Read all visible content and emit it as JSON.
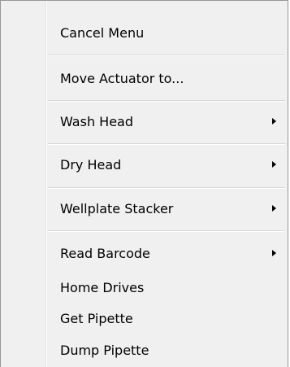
{
  "menu": {
    "items": [
      {
        "label": "Cancel Menu",
        "submenu": false
      },
      {
        "label": "Move Actuator to...",
        "submenu": false
      },
      {
        "label": "Wash Head",
        "submenu": true
      },
      {
        "label": "Dry Head",
        "submenu": true
      },
      {
        "label": "Wellplate Stacker",
        "submenu": true
      },
      {
        "label": "Read Barcode",
        "submenu": true
      },
      {
        "label": "Home Drives",
        "submenu": false
      },
      {
        "label": "Get Pipette",
        "submenu": false
      },
      {
        "label": "Dump Pipette",
        "submenu": false
      }
    ]
  },
  "colors": {
    "menu_background": "#f0f0f0",
    "border": "#979797",
    "separator": "#d7d7d7"
  }
}
